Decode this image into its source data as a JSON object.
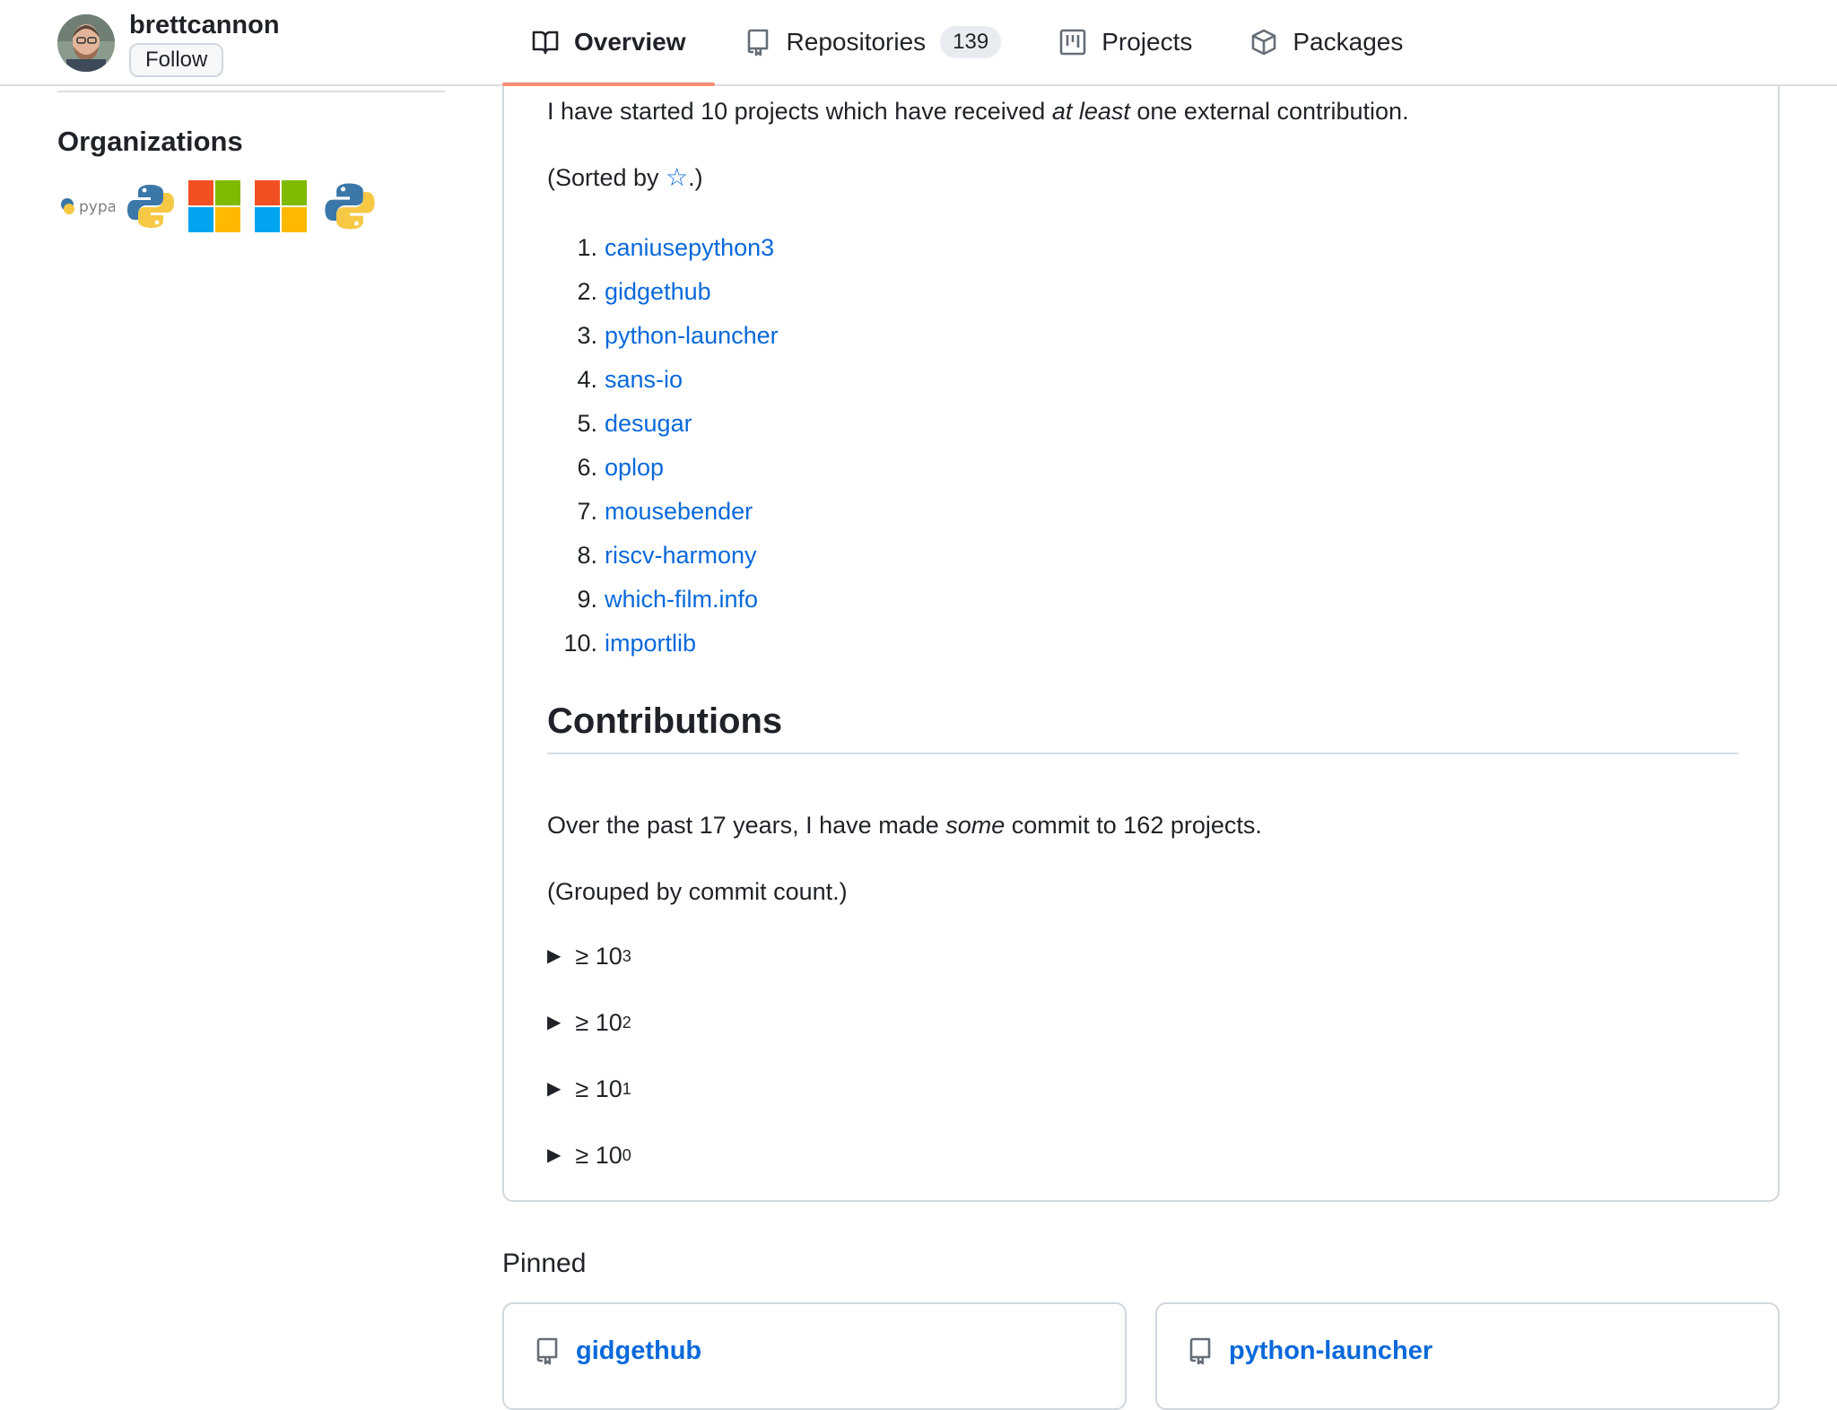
{
  "header": {
    "username": "brettcannon",
    "follow_label": "Follow",
    "tabs": [
      {
        "label": "Overview",
        "icon": "book-icon",
        "selected": true
      },
      {
        "label": "Repositories",
        "icon": "repo-icon",
        "count": "139"
      },
      {
        "label": "Projects",
        "icon": "project-board-icon"
      },
      {
        "label": "Packages",
        "icon": "package-icon"
      }
    ]
  },
  "sidebar": {
    "organizations_heading": "Organizations",
    "org_logo_text": "pypa",
    "orgs": [
      "pypa-logo",
      "python-logo",
      "microsoft-logo",
      "microsoft-logo",
      "python-logo"
    ]
  },
  "readme": {
    "intro_pre": "I have started 10 projects which have received ",
    "intro_em": "at least",
    "intro_post": " one external contribution.",
    "sorted_pre": "(Sorted by ",
    "sorted_star": "☆",
    "sorted_post": ".)",
    "projects": [
      {
        "num": "1.",
        "name": "caniusepython3"
      },
      {
        "num": "2.",
        "name": "gidgethub"
      },
      {
        "num": "3.",
        "name": "python-launcher"
      },
      {
        "num": "4.",
        "name": "sans-io"
      },
      {
        "num": "5.",
        "name": "desugar"
      },
      {
        "num": "6.",
        "name": "oplop"
      },
      {
        "num": "7.",
        "name": "mousebender"
      },
      {
        "num": "8.",
        "name": "riscv-harmony"
      },
      {
        "num": "9.",
        "name": "which-film.info"
      },
      {
        "num": "10.",
        "name": "importlib"
      }
    ],
    "contributions_heading": "Contributions",
    "past_pre": "Over the past 17 years, I have made ",
    "past_em": "some",
    "past_post": " commit to 162 projects.",
    "grouped": "(Grouped by commit count.)",
    "groups": [
      {
        "prefix": "≥ 10",
        "exp": "3"
      },
      {
        "prefix": "≥ 10",
        "exp": "2"
      },
      {
        "prefix": "≥ 10",
        "exp": "1"
      },
      {
        "prefix": "≥ 10",
        "exp": "0"
      }
    ]
  },
  "pinned": {
    "heading": "Pinned",
    "items": [
      {
        "name": "gidgethub"
      },
      {
        "name": "python-launcher"
      }
    ]
  },
  "colors": {
    "link": "#0969da",
    "tab_underline": "#fd8c73",
    "border": "#d0d7de"
  }
}
